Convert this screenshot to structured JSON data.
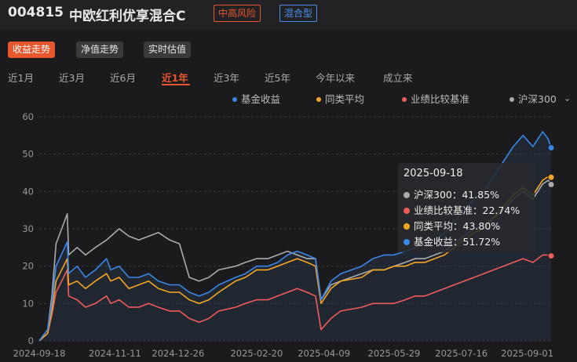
{
  "header": {
    "code": "004815",
    "name": "中欧红利优享混合C",
    "risk_tag": "中高风险",
    "type_tag": "混合型"
  },
  "chart_tabs": [
    {
      "label": "收益走势",
      "active": true
    },
    {
      "label": "净值走势",
      "active": false
    },
    {
      "label": "实时估值",
      "active": false
    }
  ],
  "periods": [
    {
      "label": "近1月",
      "active": false
    },
    {
      "label": "近3月",
      "active": false
    },
    {
      "label": "近6月",
      "active": false
    },
    {
      "label": "近1年",
      "active": true
    },
    {
      "label": "近3年",
      "active": false
    },
    {
      "label": "近5年",
      "active": false
    },
    {
      "label": "今年以来",
      "active": false
    },
    {
      "label": "成立来",
      "active": false
    }
  ],
  "legend": [
    {
      "label": "基金收益",
      "color": "#3a86e8"
    },
    {
      "label": "同类平均",
      "color": "#f5a623"
    },
    {
      "label": "业绩比较基准",
      "color": "#ee5b5b"
    },
    {
      "label": "沪深300",
      "color": "#aaaaaa"
    }
  ],
  "tooltip": {
    "date": "2025-09-18",
    "rows": [
      {
        "text": "沪深300：41.85%",
        "color": "#aaaaaa"
      },
      {
        "text": "业绩比较基准：22.74%",
        "color": "#ee5b5b"
      },
      {
        "text": "同类平均：43.80%",
        "color": "#f5a623"
      },
      {
        "text": "基金收益：51.72%",
        "color": "#3a86e8"
      }
    ]
  },
  "chart_data": {
    "type": "line",
    "ylim": [
      0,
      60
    ],
    "y_ticks": [
      0,
      10,
      20,
      30,
      40,
      50,
      60
    ],
    "x_range": [
      "2024-09-18",
      "2025-09-18"
    ],
    "x_ticks": [
      "2024-09-18",
      "2024-11-11",
      "2024-12-26",
      "2025-02-20",
      "2025-04-09",
      "2025-05-29",
      "2025-07-16",
      "2025-09-01"
    ],
    "grid": true,
    "legend_position": "top-right",
    "series": [
      {
        "name": "基金收益",
        "color": "#3a86e8",
        "points": [
          [
            "2024-09-18",
            0
          ],
          [
            "2024-09-24",
            3
          ],
          [
            "2024-09-27",
            10
          ],
          [
            "2024-09-30",
            20
          ],
          [
            "2024-10-08",
            26.5
          ],
          [
            "2024-10-09",
            18
          ],
          [
            "2024-10-15",
            20
          ],
          [
            "2024-10-21",
            17
          ],
          [
            "2024-10-28",
            19
          ],
          [
            "2024-11-05",
            22
          ],
          [
            "2024-11-08",
            19
          ],
          [
            "2024-11-14",
            20
          ],
          [
            "2024-11-21",
            17
          ],
          [
            "2024-11-28",
            17
          ],
          [
            "2024-12-05",
            18
          ],
          [
            "2024-12-12",
            16
          ],
          [
            "2024-12-20",
            15
          ],
          [
            "2024-12-27",
            15
          ],
          [
            "2025-01-03",
            13
          ],
          [
            "2025-01-10",
            12
          ],
          [
            "2025-01-17",
            13
          ],
          [
            "2025-01-24",
            15
          ],
          [
            "2025-02-05",
            17
          ],
          [
            "2025-02-12",
            18
          ],
          [
            "2025-02-20",
            20
          ],
          [
            "2025-02-28",
            20
          ],
          [
            "2025-03-07",
            21
          ],
          [
            "2025-03-14",
            23
          ],
          [
            "2025-03-21",
            24
          ],
          [
            "2025-03-28",
            23
          ],
          [
            "2025-04-03",
            22
          ],
          [
            "2025-04-07",
            11
          ],
          [
            "2025-04-14",
            16
          ],
          [
            "2025-04-21",
            18
          ],
          [
            "2025-05-06",
            20
          ],
          [
            "2025-05-14",
            22
          ],
          [
            "2025-05-22",
            23
          ],
          [
            "2025-05-29",
            23
          ],
          [
            "2025-06-06",
            24
          ],
          [
            "2025-06-13",
            25
          ],
          [
            "2025-06-20",
            26
          ],
          [
            "2025-06-27",
            27
          ],
          [
            "2025-07-04",
            29
          ],
          [
            "2025-07-11",
            32
          ],
          [
            "2025-07-18",
            35
          ],
          [
            "2025-07-25",
            38
          ],
          [
            "2025-08-01",
            40
          ],
          [
            "2025-08-08",
            44
          ],
          [
            "2025-08-15",
            48
          ],
          [
            "2025-08-22",
            52
          ],
          [
            "2025-08-29",
            55
          ],
          [
            "2025-09-05",
            52
          ],
          [
            "2025-09-12",
            56
          ],
          [
            "2025-09-16",
            54
          ],
          [
            "2025-09-18",
            51.72
          ]
        ]
      },
      {
        "name": "同类平均",
        "color": "#f5a623",
        "points": [
          [
            "2024-09-18",
            0
          ],
          [
            "2024-09-24",
            2
          ],
          [
            "2024-09-27",
            8
          ],
          [
            "2024-09-30",
            16
          ],
          [
            "2024-10-08",
            22
          ],
          [
            "2024-10-09",
            15
          ],
          [
            "2024-10-15",
            16
          ],
          [
            "2024-10-21",
            14
          ],
          [
            "2024-10-28",
            16
          ],
          [
            "2024-11-05",
            18
          ],
          [
            "2024-11-08",
            16
          ],
          [
            "2024-11-14",
            17
          ],
          [
            "2024-11-21",
            14
          ],
          [
            "2024-11-28",
            15
          ],
          [
            "2024-12-05",
            16
          ],
          [
            "2024-12-12",
            14
          ],
          [
            "2024-12-20",
            13
          ],
          [
            "2024-12-27",
            13
          ],
          [
            "2025-01-03",
            11
          ],
          [
            "2025-01-10",
            10
          ],
          [
            "2025-01-17",
            11
          ],
          [
            "2025-01-24",
            13
          ],
          [
            "2025-02-05",
            16
          ],
          [
            "2025-02-12",
            17
          ],
          [
            "2025-02-20",
            19
          ],
          [
            "2025-02-28",
            19
          ],
          [
            "2025-03-07",
            20
          ],
          [
            "2025-03-14",
            21
          ],
          [
            "2025-03-21",
            22
          ],
          [
            "2025-03-28",
            21
          ],
          [
            "2025-04-03",
            20
          ],
          [
            "2025-04-07",
            10
          ],
          [
            "2025-04-14",
            14
          ],
          [
            "2025-04-21",
            16
          ],
          [
            "2025-05-06",
            17
          ],
          [
            "2025-05-14",
            19
          ],
          [
            "2025-05-22",
            19
          ],
          [
            "2025-05-29",
            20
          ],
          [
            "2025-06-06",
            20
          ],
          [
            "2025-06-13",
            21
          ],
          [
            "2025-06-20",
            21
          ],
          [
            "2025-06-27",
            22
          ],
          [
            "2025-07-04",
            23
          ],
          [
            "2025-07-11",
            25
          ],
          [
            "2025-07-18",
            27
          ],
          [
            "2025-07-25",
            29
          ],
          [
            "2025-08-01",
            30
          ],
          [
            "2025-08-08",
            33
          ],
          [
            "2025-08-15",
            36
          ],
          [
            "2025-08-22",
            39
          ],
          [
            "2025-08-29",
            41
          ],
          [
            "2025-09-05",
            39
          ],
          [
            "2025-09-12",
            43
          ],
          [
            "2025-09-16",
            44
          ],
          [
            "2025-09-18",
            43.8
          ]
        ]
      },
      {
        "name": "业绩比较基准",
        "color": "#ee5b5b",
        "points": [
          [
            "2024-09-18",
            0
          ],
          [
            "2024-09-24",
            2
          ],
          [
            "2024-09-27",
            7
          ],
          [
            "2024-09-30",
            13
          ],
          [
            "2024-10-08",
            19
          ],
          [
            "2024-10-09",
            12
          ],
          [
            "2024-10-15",
            11
          ],
          [
            "2024-10-21",
            9
          ],
          [
            "2024-10-28",
            10
          ],
          [
            "2024-11-05",
            12
          ],
          [
            "2024-11-08",
            10
          ],
          [
            "2024-11-14",
            11
          ],
          [
            "2024-11-21",
            9
          ],
          [
            "2024-11-28",
            9
          ],
          [
            "2024-12-05",
            10
          ],
          [
            "2024-12-12",
            9
          ],
          [
            "2024-12-20",
            8
          ],
          [
            "2024-12-27",
            8
          ],
          [
            "2025-01-03",
            6
          ],
          [
            "2025-01-10",
            5
          ],
          [
            "2025-01-17",
            6
          ],
          [
            "2025-01-24",
            8
          ],
          [
            "2025-02-05",
            9
          ],
          [
            "2025-02-12",
            10
          ],
          [
            "2025-02-20",
            11
          ],
          [
            "2025-02-28",
            11
          ],
          [
            "2025-03-07",
            12
          ],
          [
            "2025-03-14",
            13
          ],
          [
            "2025-03-21",
            14
          ],
          [
            "2025-03-28",
            13
          ],
          [
            "2025-04-03",
            12
          ],
          [
            "2025-04-07",
            3
          ],
          [
            "2025-04-14",
            6
          ],
          [
            "2025-04-21",
            8
          ],
          [
            "2025-05-06",
            9
          ],
          [
            "2025-05-14",
            10
          ],
          [
            "2025-05-22",
            10
          ],
          [
            "2025-05-29",
            10
          ],
          [
            "2025-06-06",
            11
          ],
          [
            "2025-06-13",
            12
          ],
          [
            "2025-06-20",
            12
          ],
          [
            "2025-06-27",
            13
          ],
          [
            "2025-07-04",
            14
          ],
          [
            "2025-07-11",
            15
          ],
          [
            "2025-07-18",
            16
          ],
          [
            "2025-07-25",
            17
          ],
          [
            "2025-08-01",
            18
          ],
          [
            "2025-08-08",
            19
          ],
          [
            "2025-08-15",
            20
          ],
          [
            "2025-08-22",
            21
          ],
          [
            "2025-08-29",
            22
          ],
          [
            "2025-09-05",
            21
          ],
          [
            "2025-09-12",
            23
          ],
          [
            "2025-09-16",
            23
          ],
          [
            "2025-09-18",
            22.74
          ]
        ]
      },
      {
        "name": "沪深300",
        "color": "#aaaaaa",
        "points": [
          [
            "2024-09-18",
            0
          ],
          [
            "2024-09-24",
            3
          ],
          [
            "2024-09-27",
            12
          ],
          [
            "2024-09-30",
            26
          ],
          [
            "2024-10-08",
            34
          ],
          [
            "2024-10-09",
            23
          ],
          [
            "2024-10-15",
            25
          ],
          [
            "2024-10-21",
            23
          ],
          [
            "2024-10-28",
            25
          ],
          [
            "2024-11-05",
            27
          ],
          [
            "2024-11-08",
            28
          ],
          [
            "2024-11-14",
            30
          ],
          [
            "2024-11-21",
            28
          ],
          [
            "2024-11-28",
            27
          ],
          [
            "2024-12-05",
            28
          ],
          [
            "2024-12-12",
            29
          ],
          [
            "2024-12-20",
            27
          ],
          [
            "2024-12-27",
            26
          ],
          [
            "2025-01-03",
            17
          ],
          [
            "2025-01-10",
            16
          ],
          [
            "2025-01-17",
            17
          ],
          [
            "2025-01-24",
            19
          ],
          [
            "2025-02-05",
            20
          ],
          [
            "2025-02-12",
            21
          ],
          [
            "2025-02-20",
            22
          ],
          [
            "2025-02-28",
            22
          ],
          [
            "2025-03-07",
            23
          ],
          [
            "2025-03-14",
            24
          ],
          [
            "2025-03-21",
            23
          ],
          [
            "2025-03-28",
            22
          ],
          [
            "2025-04-03",
            22
          ],
          [
            "2025-04-07",
            11
          ],
          [
            "2025-04-14",
            15
          ],
          [
            "2025-04-21",
            16
          ],
          [
            "2025-05-06",
            18
          ],
          [
            "2025-05-14",
            19
          ],
          [
            "2025-05-22",
            19
          ],
          [
            "2025-05-29",
            20
          ],
          [
            "2025-06-06",
            21
          ],
          [
            "2025-06-13",
            22
          ],
          [
            "2025-06-20",
            22
          ],
          [
            "2025-06-27",
            23
          ],
          [
            "2025-07-04",
            24
          ],
          [
            "2025-07-11",
            26
          ],
          [
            "2025-07-18",
            28
          ],
          [
            "2025-07-25",
            30
          ],
          [
            "2025-08-01",
            31
          ],
          [
            "2025-08-08",
            33
          ],
          [
            "2025-08-15",
            35
          ],
          [
            "2025-08-22",
            38
          ],
          [
            "2025-08-29",
            40
          ],
          [
            "2025-09-05",
            38
          ],
          [
            "2025-09-12",
            42
          ],
          [
            "2025-09-16",
            43
          ],
          [
            "2025-09-18",
            41.85
          ]
        ]
      }
    ]
  }
}
